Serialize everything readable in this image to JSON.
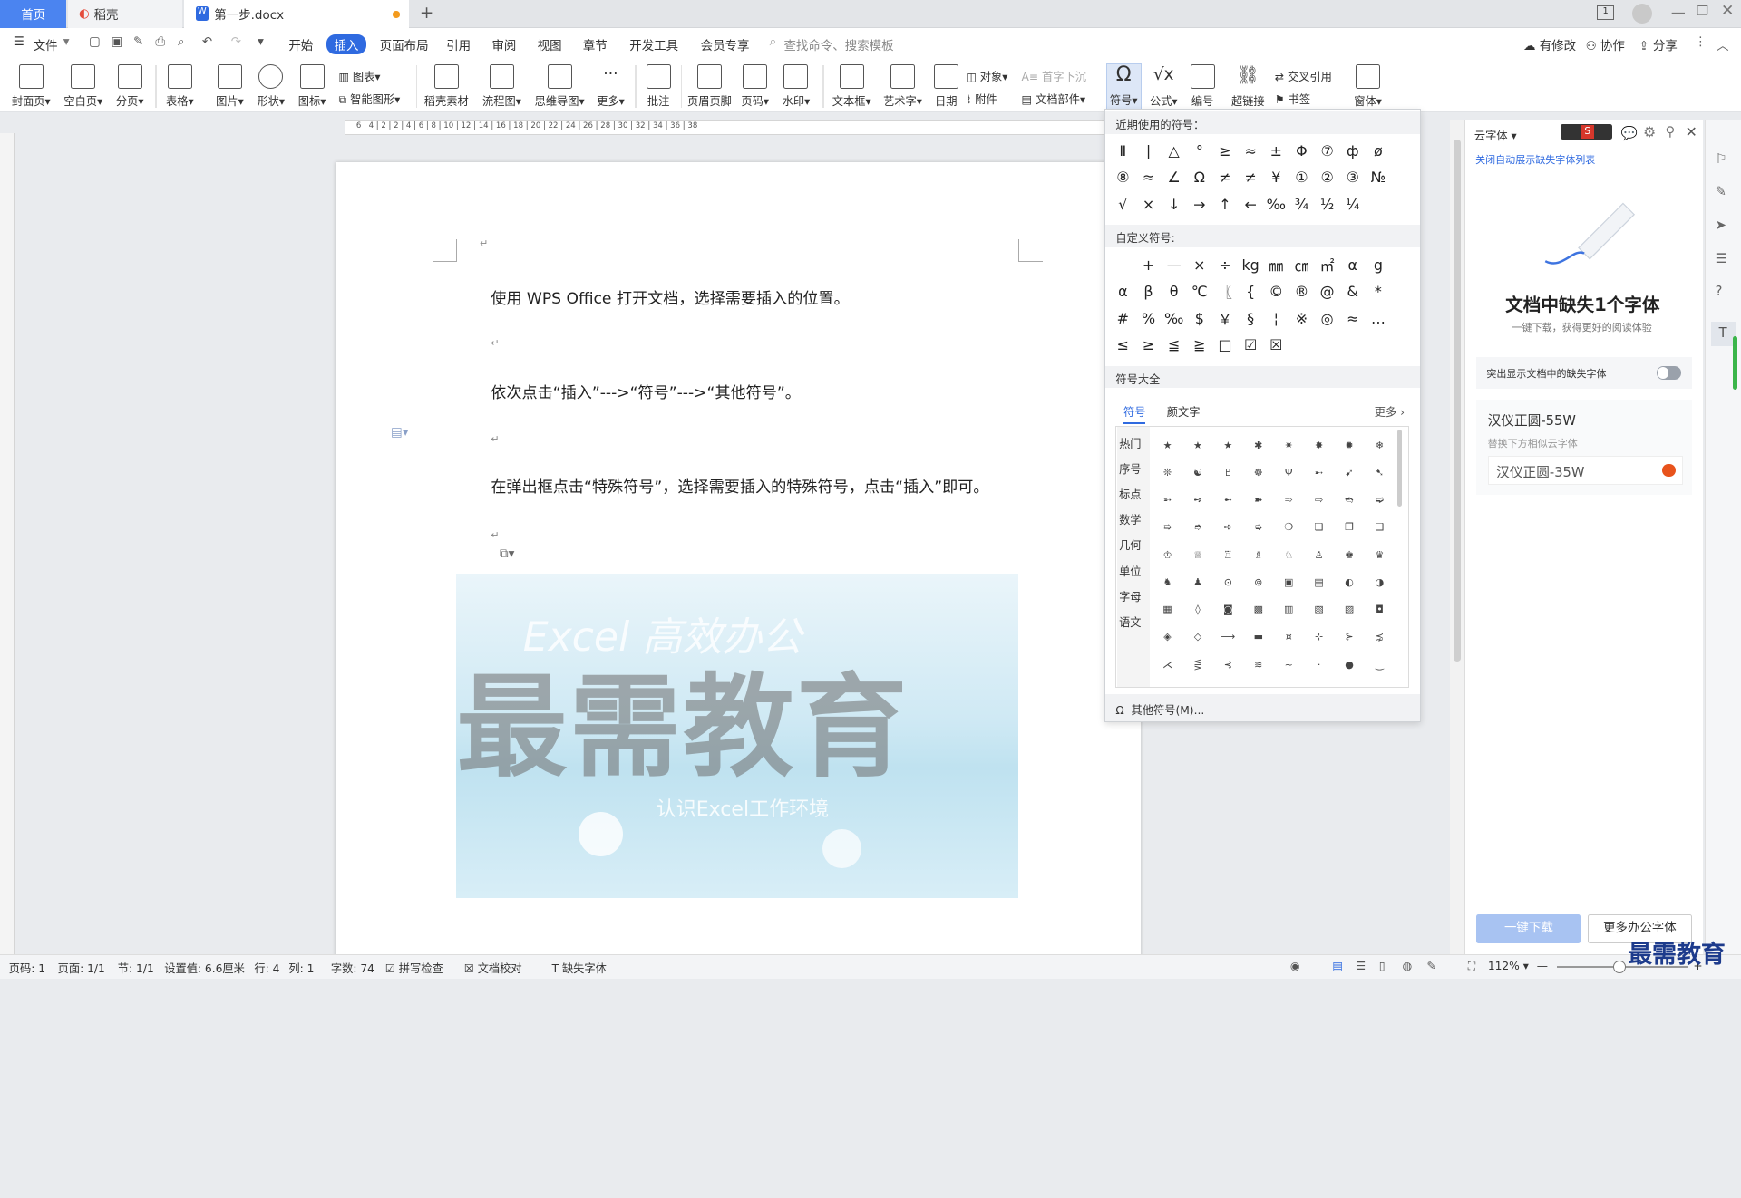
{
  "tabs": {
    "home": "首页",
    "daoke": "稻壳",
    "doc": "第一步.docx",
    "add": "+"
  },
  "menu": {
    "file": "文件",
    "items": [
      "开始",
      "插入",
      "页面布局",
      "引用",
      "审阅",
      "视图",
      "章节",
      "开发工具",
      "会员专享"
    ],
    "search_placeholder": "查找命令、搜索模板",
    "right": [
      "有修改",
      "协作",
      "分享"
    ]
  },
  "ribbon": {
    "cover": "封面页",
    "blank": "空白页",
    "pagebreak": "分页",
    "table": "表格",
    "picture": "图片",
    "shape": "形状",
    "icon": "图标",
    "chart": "图表",
    "smartart": "智能图形",
    "daoke": "稻壳素材",
    "flow": "流程图",
    "mind": "思维导图",
    "more": "更多",
    "comment": "批注",
    "header": "页眉页脚",
    "pagenum": "页码",
    "watermark": "水印",
    "textbox": "文本框",
    "art": "艺术字",
    "date": "日期",
    "object": "对象",
    "attach": "附件",
    "dropcap": "首字下沉",
    "docpart": "文档部件",
    "symbol": "符号",
    "formula": "公式",
    "numbering": "编号",
    "link": "超链接",
    "crossref": "交叉引用",
    "bookmark": "书签",
    "form": "窗体"
  },
  "doc": {
    "p1": "使用 WPS Office 打开文档，选择需要插入的位置。",
    "p2": "依次点击“插入”--->“符号”--->“其他符号”。",
    "p3": "在弹出框点击“特殊符号”，选择需要插入的特殊符号，点击“插入”即可。",
    "banner_top": "Excel 高效办公",
    "banner_big": "最需教育",
    "banner_sub": "认识Excel工作环境"
  },
  "symbols": {
    "recent_title": "近期使用的符号：",
    "recent": [
      "Ⅱ",
      "|",
      "△",
      "°",
      "≥",
      "≈",
      "±",
      "Φ",
      "⑦",
      "ф",
      "ø",
      "⑧",
      "≈",
      "∠",
      "Ω",
      "≠",
      "≠",
      "¥",
      "①",
      "②",
      "③",
      "№",
      "√",
      "×",
      "↓",
      "→",
      "↑",
      "←",
      "‰",
      "¾",
      "½",
      "¼"
    ],
    "custom_title": "自定义符号:",
    "custom": [
      "",
      "+",
      "—",
      "×",
      "÷",
      "kg",
      "㎜",
      "㎝",
      "㎡",
      "α",
      "g",
      "α",
      "β",
      "θ",
      "℃",
      "〖",
      "{",
      "©",
      "®",
      "@",
      "&",
      "*",
      "#",
      "%",
      "‰",
      "$",
      "￥",
      "§",
      "¦",
      "※",
      "◎",
      "≈",
      "…",
      "≤",
      "≥",
      "≦",
      "≧",
      "□",
      "☑",
      "☒"
    ],
    "all_title": "符号大全",
    "tab_symbol": "符号",
    "tab_emoji": "颜文字",
    "more": "更多",
    "categories": [
      "热门",
      "序号",
      "标点",
      "数学",
      "几何",
      "单位",
      "字母",
      "语文"
    ],
    "grid": [
      "★",
      "★",
      "★",
      "✱",
      "✷",
      "✸",
      "✹",
      "❄",
      "❊",
      "☯",
      "♇",
      "☸",
      "Ψ",
      "➸",
      "➹",
      "➷",
      "➵",
      "➺",
      "➻",
      "➽",
      "➾",
      "⇨",
      "➬",
      "➫",
      "➯",
      "➮",
      "➪",
      "➭",
      "❍",
      "❏",
      "❐",
      "❑",
      "♔",
      "♕",
      "♖",
      "♗",
      "♘",
      "♙",
      "♚",
      "♛",
      "♞",
      "♟",
      "⊙",
      "⊚",
      "▣",
      "▤",
      "◐",
      "◑",
      "▦",
      "◊",
      "◙",
      "▩",
      "▥",
      "▧",
      "▨",
      "◘",
      "◈",
      "◇",
      "⟶",
      "▬",
      "¤",
      "⊹",
      "⊱",
      "⋨",
      "⋌",
      "⋚",
      "⊰",
      "≋",
      "~",
      "·",
      "●",
      "‿"
    ],
    "other": "其他符号(M)..."
  },
  "rpanel": {
    "title": "云字体",
    "close_list": "关闭自动展示缺失字体列表",
    "heading": "文档中缺失1个字体",
    "sub": "一键下载，获得更好的阅读体验",
    "highlight": "突出显示文档中的缺失字体",
    "font_name": "汉仪正圆-55W",
    "replace_hint": "替换下方相似云字体",
    "replace_font": "汉仪正圆-35W",
    "btn_download": "一键下载",
    "btn_more": "更多办公字体"
  },
  "status": {
    "page": "页码: 1",
    "pages": "页面: 1/1",
    "section": "节: 1/1",
    "setting": "设置值: 6.6厘米",
    "row": "行: 4",
    "col": "列: 1",
    "words": "字数: 74",
    "spell": "拼写检查",
    "proof": "文档校对",
    "missing": "缺失字体",
    "zoom": "112%"
  },
  "watermark": "最需教育"
}
